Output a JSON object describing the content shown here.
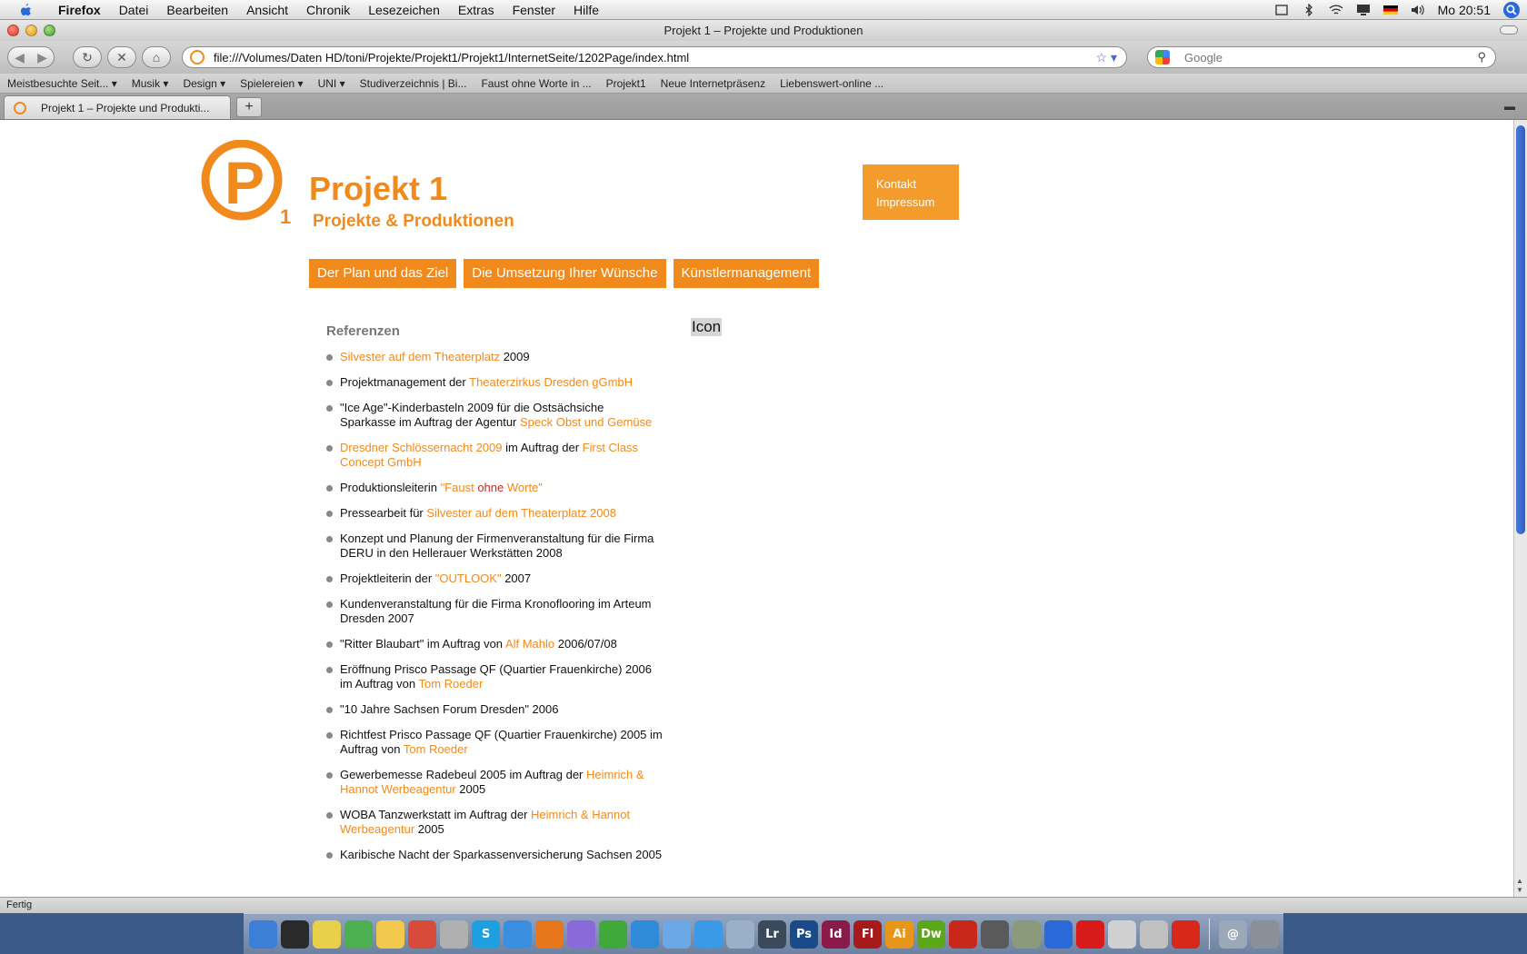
{
  "menubar": {
    "app_name": "Firefox",
    "items": [
      "Datei",
      "Bearbeiten",
      "Ansicht",
      "Chronik",
      "Lesezeichen",
      "Extras",
      "Fenster",
      "Hilfe"
    ],
    "clock": "Mo 20:51"
  },
  "window": {
    "title": "Projekt 1 – Projekte und Produktionen"
  },
  "navbar": {
    "url": "file:///Volumes/Daten HD/toni/Projekte/Projekt1/Projekt1/InternetSeite/1202Page/index.html",
    "search_placeholder": "Google"
  },
  "bookmarks": [
    "Meistbesuchte Seit... ▾",
    "Musik ▾",
    "Design ▾",
    "Spielereien ▾",
    "UNI ▾",
    "Studiverzeichnis | Bi...",
    "Faust ohne Worte in ...",
    "Projekt1",
    "Neue Internetpräsenz",
    "Liebenswert-online ..."
  ],
  "tab": {
    "label": "Projekt 1 – Projekte und Produkti..."
  },
  "page": {
    "logo_title": "Projekt 1",
    "logo_subtitle": "Projekte & Produktionen",
    "logo_letter": "P",
    "logo_index": "1",
    "side_links": [
      "Kontakt",
      "Impressum"
    ],
    "nav": [
      "Der Plan und das Ziel",
      "Die Umsetzung Ihrer Wünsche",
      "Künstlermanagement"
    ],
    "section_title": "Referenzen",
    "icon_label": "Icon",
    "references": [
      [
        {
          "t": "Silvester auf dem Theaterplatz",
          "link": true
        },
        {
          "t": " 2009"
        }
      ],
      [
        {
          "t": "Projektmanagement der "
        },
        {
          "t": "Theaterzirkus Dresden gGmbH",
          "link": true
        }
      ],
      [
        {
          "t": "\"Ice Age\"-Kinderbasteln 2009 für die Ostsächsiche Sparkasse im Auftrag der Agentur "
        },
        {
          "t": "Speck Obst und Gemüse",
          "link": true
        }
      ],
      [
        {
          "t": "Dresdner Schlössernacht 2009",
          "link": true
        },
        {
          "t": " im Auftrag der "
        },
        {
          "t": "First Class Concept GmbH",
          "link": true
        }
      ],
      [
        {
          "t": "Produktionsleiterin "
        },
        {
          "t": "\"Faust ",
          "link": true
        },
        {
          "t": "ohne",
          "red": true
        },
        {
          "t": " Worte\"",
          "link": true
        }
      ],
      [
        {
          "t": "Pressearbeit für "
        },
        {
          "t": "Silvester auf dem Theaterplatz 2008",
          "link": true
        }
      ],
      [
        {
          "t": "Konzept und Planung der Firmenveranstaltung für die Firma DERU in den Hellerauer Werkstätten 2008"
        }
      ],
      [
        {
          "t": "Projektleiterin der "
        },
        {
          "t": "\"OUTLOOK\"",
          "link": true
        },
        {
          "t": " 2007"
        }
      ],
      [
        {
          "t": "Kundenveranstaltung für die Firma Kronoflooring im Arteum Dresden 2007"
        }
      ],
      [
        {
          "t": "\"Ritter Blaubart\" im Auftrag von "
        },
        {
          "t": "Alf Mahlo",
          "link": true
        },
        {
          "t": " 2006/07/08"
        }
      ],
      [
        {
          "t": "Eröffnung Prisco Passage QF (Quartier Frauenkirche) 2006 im Auftrag von "
        },
        {
          "t": "Tom Roeder",
          "link": true
        }
      ],
      [
        {
          "t": "\"10 Jahre Sachsen Forum Dresden\" 2006"
        }
      ],
      [
        {
          "t": "Richtfest Prisco Passage QF (Quartier Frauenkirche) 2005 im Auftrag von "
        },
        {
          "t": "Tom Roeder",
          "link": true
        }
      ],
      [
        {
          "t": "Gewerbemesse Radebeul 2005 im Auftrag der "
        },
        {
          "t": "Heimrich & Hannot Werbeagentur",
          "link": true
        },
        {
          "t": " 2005"
        }
      ],
      [
        {
          "t": "WOBA Tanzwerkstatt im Auftrag der "
        },
        {
          "t": "Heimrich & Hannot Werbeagentur",
          "link": true
        },
        {
          "t": " 2005"
        }
      ],
      [
        {
          "t": "Karibische Nacht der Sparkassenversicherung Sachsen 2005"
        }
      ]
    ]
  },
  "status": {
    "text": "Fertig"
  },
  "dock": [
    {
      "name": "finder-icon",
      "label": "",
      "color": "#3b7fd6"
    },
    {
      "name": "dashboard-icon",
      "label": "",
      "color": "#2a2a2a"
    },
    {
      "name": "stickies-icon",
      "label": "",
      "color": "#e8d04a"
    },
    {
      "name": "adium-icon",
      "label": "",
      "color": "#4caf50"
    },
    {
      "name": "cyberduck-icon",
      "label": "",
      "color": "#f2c94c"
    },
    {
      "name": "calendar-icon",
      "label": "",
      "color": "#d84a3a"
    },
    {
      "name": "itunes-icon",
      "label": "",
      "color": "#b0b0b0"
    },
    {
      "name": "skype-icon",
      "label": "S",
      "color": "#1ea0e0"
    },
    {
      "name": "safari-icon",
      "label": "",
      "color": "#3a8ee0"
    },
    {
      "name": "firefox-icon",
      "label": "",
      "color": "#e8761a"
    },
    {
      "name": "app-purple-icon",
      "label": "",
      "color": "#8a6ad8"
    },
    {
      "name": "app-green-icon",
      "label": "",
      "color": "#3faa3a"
    },
    {
      "name": "app-blue-icon",
      "label": "",
      "color": "#2f8ad8"
    },
    {
      "name": "itunes-note-icon",
      "label": "",
      "color": "#6aa8e8"
    },
    {
      "name": "app-swirl-icon",
      "label": "",
      "color": "#3a9ae8"
    },
    {
      "name": "preview-icon",
      "label": "",
      "color": "#9ab0c8"
    },
    {
      "name": "lightroom-icon",
      "label": "Lr",
      "color": "#3a4a5a"
    },
    {
      "name": "photoshop-icon",
      "label": "Ps",
      "color": "#1a4a8a"
    },
    {
      "name": "indesign-icon",
      "label": "Id",
      "color": "#8a1a4a"
    },
    {
      "name": "flash-icon",
      "label": "Fl",
      "color": "#a81a1a"
    },
    {
      "name": "illustrator-icon",
      "label": "Ai",
      "color": "#e8961a"
    },
    {
      "name": "dreamweaver-icon",
      "label": "Dw",
      "color": "#5aa81a"
    },
    {
      "name": "acrobat-icon",
      "label": "",
      "color": "#c8281a"
    },
    {
      "name": "acrobat-reader-icon",
      "label": "",
      "color": "#5a5a5a"
    },
    {
      "name": "printer-icon",
      "label": "",
      "color": "#8a9a7a"
    },
    {
      "name": "home-icon",
      "label": "",
      "color": "#2a6ad8"
    },
    {
      "name": "lastfm-icon",
      "label": "",
      "color": "#d81a1a"
    },
    {
      "name": "scanner-icon",
      "label": "",
      "color": "#d0d0d0"
    },
    {
      "name": "dvd-player-icon",
      "label": "",
      "color": "#c0c0c0"
    },
    {
      "name": "flashcards-icon",
      "label": "",
      "color": "#d8281a"
    },
    {
      "name": "mail-icon",
      "label": "@",
      "color": "#9aa8b8"
    },
    {
      "name": "trash-icon",
      "label": "",
      "color": "#8a9098"
    }
  ]
}
